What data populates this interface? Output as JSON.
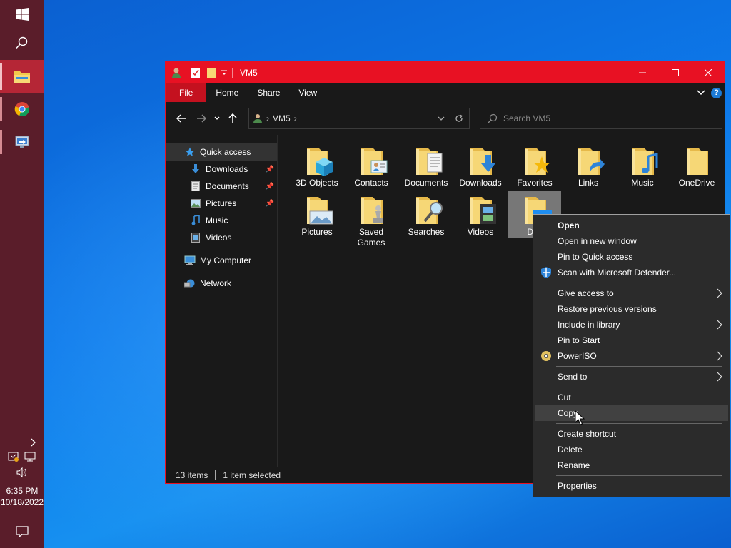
{
  "taskbar": {
    "items": [
      {
        "name": "start-button"
      },
      {
        "name": "search-button"
      },
      {
        "name": "file-explorer-app",
        "active": true
      },
      {
        "name": "chrome-app"
      },
      {
        "name": "remote-desktop-app"
      }
    ],
    "clock": {
      "time": "6:35 PM",
      "date": "10/18/2022"
    }
  },
  "window": {
    "title": "VM5",
    "ribbon_tabs": [
      "File",
      "Home",
      "Share",
      "View"
    ],
    "address": {
      "crumb": "VM5"
    },
    "search": {
      "placeholder": "Search VM5"
    },
    "nav_pane": [
      {
        "label": "Quick access",
        "icon": "star-icon",
        "selected": true
      },
      {
        "label": "Downloads",
        "icon": "download-icon",
        "pinned": true
      },
      {
        "label": "Documents",
        "icon": "document-icon",
        "pinned": true
      },
      {
        "label": "Pictures",
        "icon": "pictures-icon",
        "pinned": true
      },
      {
        "label": "Music",
        "icon": "music-icon"
      },
      {
        "label": "Videos",
        "icon": "video-icon"
      },
      {
        "label": "My Computer",
        "icon": "computer-icon"
      },
      {
        "label": "Network",
        "icon": "network-icon"
      }
    ],
    "folders": [
      {
        "label": "3D Objects",
        "overlay": "cube"
      },
      {
        "label": "Contacts",
        "overlay": "contact"
      },
      {
        "label": "Documents",
        "overlay": "doc"
      },
      {
        "label": "Downloads",
        "overlay": "arrow"
      },
      {
        "label": "Favorites",
        "overlay": "star"
      },
      {
        "label": "Links",
        "overlay": "link"
      },
      {
        "label": "Music",
        "overlay": "note"
      },
      {
        "label": "OneDrive",
        "overlay": "none"
      },
      {
        "label": "Pictures",
        "overlay": "picture"
      },
      {
        "label": "Saved\nGames",
        "overlay": "chess"
      },
      {
        "label": "Searches",
        "overlay": "magnifier"
      },
      {
        "label": "Videos",
        "overlay": "film"
      },
      {
        "label": "Des",
        "overlay": "desktop",
        "selected": true
      }
    ],
    "status": {
      "count": "13 items",
      "selection": "1 item selected"
    }
  },
  "context_menu": {
    "items": [
      {
        "label": "Open",
        "bold": true
      },
      {
        "label": "Open in new window"
      },
      {
        "label": "Pin to Quick access"
      },
      {
        "label": "Scan with Microsoft Defender...",
        "icon": "defender-icon"
      },
      {
        "separator": true
      },
      {
        "label": "Give access to",
        "submenu": true
      },
      {
        "label": "Restore previous versions"
      },
      {
        "label": "Include in library",
        "submenu": true
      },
      {
        "label": "Pin to Start"
      },
      {
        "label": "PowerISO",
        "submenu": true,
        "icon": "poweriso-icon"
      },
      {
        "separator": true
      },
      {
        "label": "Send to",
        "submenu": true
      },
      {
        "separator": true
      },
      {
        "label": "Cut"
      },
      {
        "label": "Copy",
        "hover": true
      },
      {
        "separator": true
      },
      {
        "label": "Create shortcut"
      },
      {
        "label": "Delete"
      },
      {
        "label": "Rename"
      },
      {
        "separator": true
      },
      {
        "label": "Properties"
      }
    ]
  },
  "colors": {
    "accent": "#e81123",
    "taskbar": "#5a1d2a",
    "window_bg": "#191919",
    "menu_bg": "#2b2b2b"
  }
}
